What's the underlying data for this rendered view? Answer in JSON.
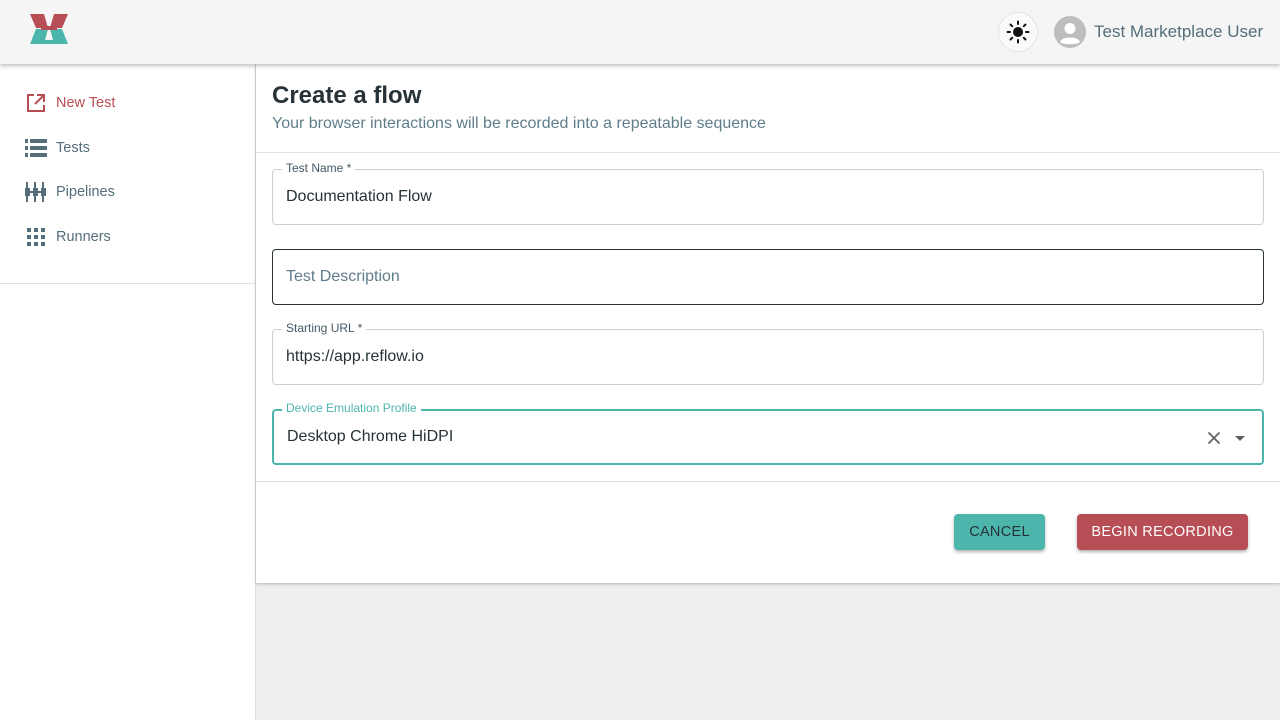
{
  "app": {
    "user_name": "Test Marketplace User"
  },
  "header": {
    "logo_icon": "reflow-logo-icon",
    "theme_toggle_icon": "sun-icon",
    "avatar_icon": "account-circle-icon"
  },
  "sidebar": {
    "items": [
      {
        "label": "New Test",
        "icon": "open-in-new-icon",
        "active": true
      },
      {
        "label": "Tests",
        "icon": "list-icon",
        "active": false
      },
      {
        "label": "Pipelines",
        "icon": "pipeline-icon",
        "active": false
      },
      {
        "label": "Runners",
        "icon": "grid-icon",
        "active": false
      }
    ]
  },
  "main": {
    "title": "Create a flow",
    "subtitle": "Your browser interactions will be recorded into a repeatable sequence",
    "fields": {
      "test_name": {
        "label": "Test Name *",
        "value": "Documentation Flow"
      },
      "test_description": {
        "placeholder": "Test Description",
        "value": ""
      },
      "starting_url": {
        "label": "Starting URL *",
        "value": "https://app.reflow.io"
      },
      "device_profile": {
        "label": "Device Emulation Profile",
        "value": "Desktop Chrome HiDPI"
      }
    },
    "actions": {
      "cancel_label": "CANCEL",
      "record_label": "BEGIN RECORDING"
    }
  },
  "colors": {
    "teal": "#4db6ac",
    "red": "#b74d55",
    "text": "#263238",
    "muted": "#607d8b"
  }
}
